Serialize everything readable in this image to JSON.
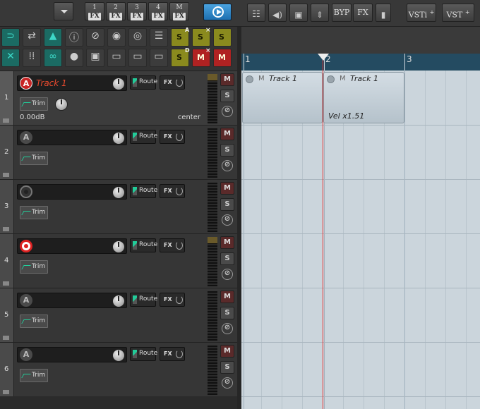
{
  "toolbar": {
    "fx_buttons": [
      {
        "num": "1",
        "label": "FX"
      },
      {
        "num": "2",
        "label": "FX"
      },
      {
        "num": "3",
        "label": "FX"
      },
      {
        "num": "4",
        "label": "FX"
      },
      {
        "num": "M",
        "label": "FX"
      }
    ],
    "byp_label": "BYP",
    "fx_label": "FX",
    "vsti_label": "VSTi",
    "vst_label": "VST",
    "plus": "+"
  },
  "tcp_toolbar": {
    "s_label": "S",
    "m_label": "M",
    "a_badge": "A",
    "d_badge": "D",
    "x_badge": "×"
  },
  "tracks": [
    {
      "number": "1",
      "name": "Track 1",
      "rec": "A",
      "volume": "0.00dB",
      "pan": "center",
      "route": "Route",
      "fx": "FX",
      "trim": "Trim",
      "m": "M",
      "s": "S",
      "phase": "⊘"
    },
    {
      "number": "2",
      "name": "",
      "rec": "A",
      "route": "Route",
      "fx": "FX",
      "trim": "Trim",
      "m": "M",
      "s": "S",
      "phase": "⊘"
    },
    {
      "number": "3",
      "name": "",
      "rec": "",
      "route": "Route",
      "fx": "FX",
      "trim": "Trim",
      "m": "M",
      "s": "S",
      "phase": "⊘"
    },
    {
      "number": "4",
      "name": "",
      "rec": "",
      "route": "Route",
      "fx": "FX",
      "trim": "Trim",
      "m": "M",
      "s": "S",
      "phase": "⊘"
    },
    {
      "number": "5",
      "name": "",
      "rec": "A",
      "route": "Route",
      "fx": "FX",
      "trim": "Trim",
      "m": "M",
      "s": "S",
      "phase": "⊘"
    },
    {
      "number": "6",
      "name": "",
      "rec": "A",
      "route": "Route",
      "fx": "FX",
      "trim": "Trim",
      "m": "M",
      "s": "S",
      "phase": "⊘"
    }
  ],
  "ruler": {
    "marks": [
      "1",
      "2",
      "3"
    ]
  },
  "items": [
    {
      "mute": "M",
      "name": "Track 1",
      "label": ""
    },
    {
      "mute": "M",
      "name": "Track 1",
      "label": "Vel x1.51"
    }
  ],
  "colors": {
    "accent": "#e84a2e",
    "ruler": "#244b61",
    "cursor": "#e53434"
  }
}
